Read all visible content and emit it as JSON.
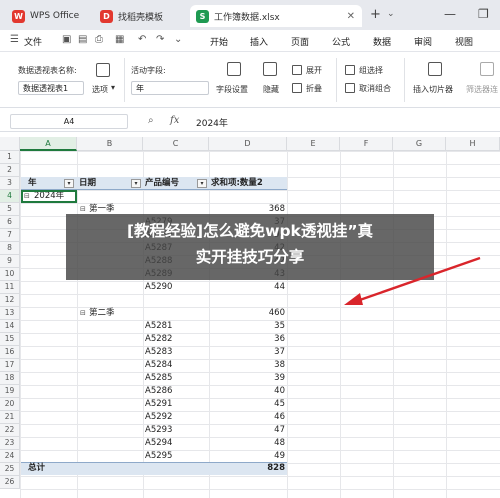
{
  "titlebar": {
    "tabs": [
      {
        "label": "WPS Office",
        "icon": "wps-logo-icon"
      },
      {
        "label": "找稻壳模板",
        "icon": "docer-icon"
      },
      {
        "label": "工作簿数据.xlsx",
        "icon": "spreadsheet-icon",
        "icon_letter": "S"
      }
    ],
    "new_tab": "+"
  },
  "menubar": {
    "file": "文件",
    "items": [
      "开始",
      "插入",
      "页面",
      "公式",
      "数据",
      "审阅",
      "视图"
    ]
  },
  "ribbon": {
    "pivot_name_label": "数据透视表名称:",
    "pivot_name_value": "数据透视表1",
    "options_label": "选项",
    "active_field_label": "活动字段:",
    "active_field_value": "年",
    "field_settings": "字段设置",
    "hide": "隐藏",
    "expand": "展开",
    "collapse": "折叠",
    "group_selection": "组选择",
    "ungroup": "取消组合",
    "insert_slicer": "插入切片器",
    "filter_connections": "筛选器连"
  },
  "formula_bar": {
    "cell_ref": "A4",
    "formula": "2024年"
  },
  "columns": [
    "A",
    "B",
    "C",
    "D",
    "E",
    "F",
    "G",
    "H"
  ],
  "rows": [
    "1",
    "2",
    "3",
    "4",
    "5",
    "6",
    "7",
    "8",
    "9",
    "10",
    "11",
    "12",
    "13",
    "14",
    "15",
    "16",
    "17",
    "18",
    "19",
    "20",
    "21",
    "22",
    "23",
    "24",
    "25",
    "26"
  ],
  "pivot": {
    "headers": [
      "年",
      "日期",
      "产品编号",
      "求和项:数量2"
    ],
    "year": "2024年",
    "q1_label": "第一季",
    "q1_total": "368",
    "q1_rows": [
      {
        "code": "A5279",
        "qty": "37"
      },
      {
        "code": "A5280",
        "qty": "94"
      },
      {
        "code": "A5287",
        "qty": "42"
      },
      {
        "code": "A5288",
        "qty": "42"
      },
      {
        "code": "A5289",
        "qty": "43"
      },
      {
        "code": "A5290",
        "qty": "44"
      }
    ],
    "q2_label": "第二季",
    "q2_total": "460",
    "q2_rows": [
      {
        "code": "A5281",
        "qty": "35"
      },
      {
        "code": "A5282",
        "qty": "36"
      },
      {
        "code": "A5283",
        "qty": "37"
      },
      {
        "code": "A5284",
        "qty": "38"
      },
      {
        "code": "A5285",
        "qty": "39"
      },
      {
        "code": "A5286",
        "qty": "40"
      },
      {
        "code": "A5291",
        "qty": "45"
      },
      {
        "code": "A5292",
        "qty": "46"
      },
      {
        "code": "A5293",
        "qty": "47"
      },
      {
        "code": "A5294",
        "qty": "48"
      },
      {
        "code": "A5295",
        "qty": "49"
      }
    ],
    "total_label": "总计",
    "total_value": "828"
  },
  "overlay": {
    "line1": "[教程经验]怎么避免wpk透视挂”真",
    "line2": "实开挂技巧分享"
  },
  "colors": {
    "accent_green": "#1f7a3d",
    "pivot_header_bg": "#dce6f1",
    "arrow_red": "#d9252b"
  }
}
